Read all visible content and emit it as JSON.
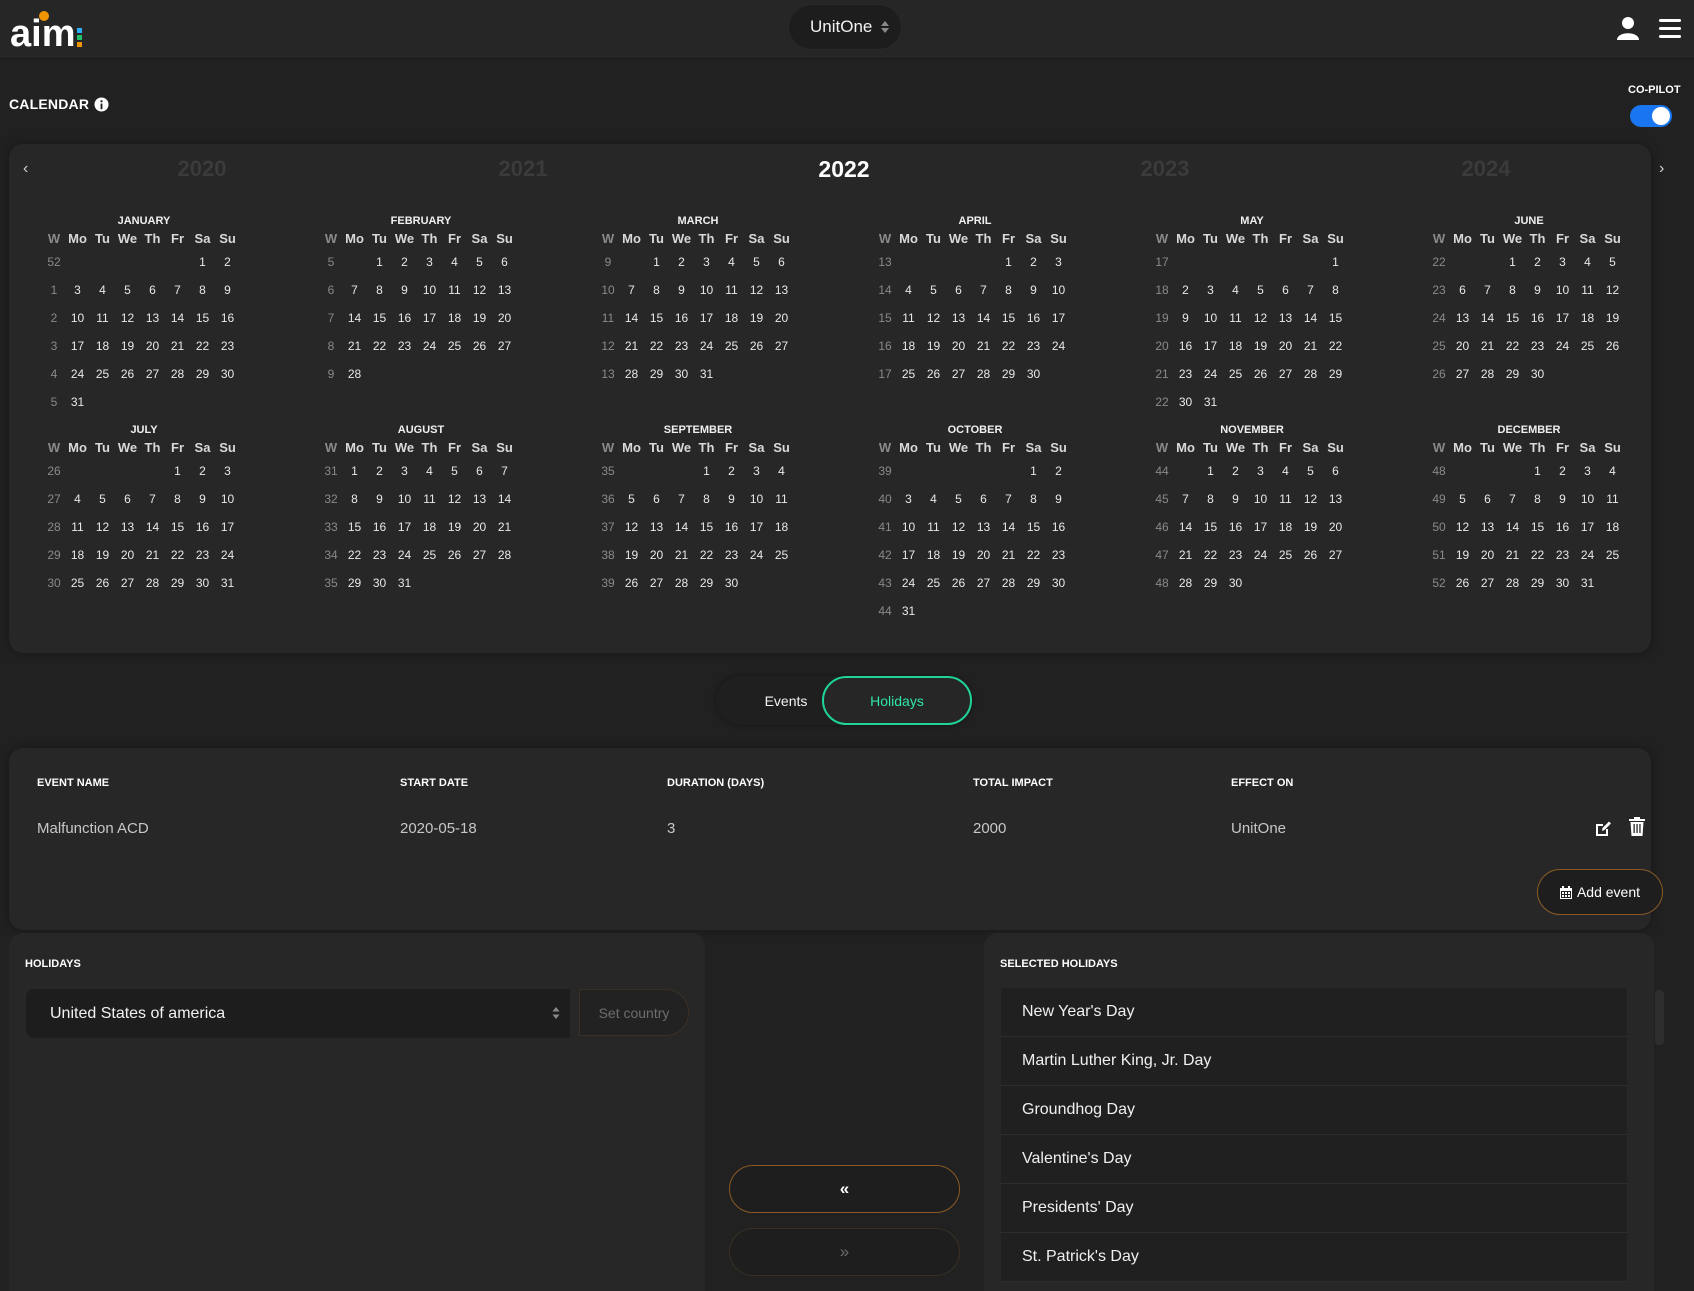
{
  "header": {
    "logo_text": "aim",
    "unit_selector": "UnitOne"
  },
  "calendar": {
    "title": "CALENDAR",
    "copilot_label": "CO-PILOT",
    "copilot_on": true,
    "years": [
      "2020",
      "2021",
      "2022",
      "2023",
      "2024"
    ],
    "current_year": "2022",
    "prev_arrow": "‹",
    "next_arrow": "›",
    "weekday_header": [
      "W",
      "Mo",
      "Tu",
      "We",
      "Th",
      "Fr",
      "Sa",
      "Su"
    ],
    "months": [
      {
        "name": "JANUARY",
        "weeks": [
          [
            52,
            "",
            "",
            "",
            "",
            "",
            1,
            2
          ],
          [
            1,
            3,
            4,
            5,
            6,
            7,
            8,
            9
          ],
          [
            2,
            10,
            11,
            12,
            13,
            14,
            15,
            16
          ],
          [
            3,
            17,
            18,
            19,
            20,
            21,
            22,
            23
          ],
          [
            4,
            24,
            25,
            26,
            27,
            28,
            29,
            30
          ],
          [
            5,
            31,
            "",
            "",
            "",
            "",
            "",
            ""
          ]
        ]
      },
      {
        "name": "FEBRUARY",
        "weeks": [
          [
            5,
            "",
            1,
            2,
            3,
            4,
            5,
            6
          ],
          [
            6,
            7,
            8,
            9,
            10,
            11,
            12,
            13
          ],
          [
            7,
            14,
            15,
            16,
            17,
            18,
            19,
            20
          ],
          [
            8,
            21,
            22,
            23,
            24,
            25,
            26,
            27
          ],
          [
            9,
            28,
            "",
            "",
            "",
            "",
            "",
            ""
          ]
        ]
      },
      {
        "name": "MARCH",
        "weeks": [
          [
            9,
            "",
            1,
            2,
            3,
            4,
            5,
            6
          ],
          [
            10,
            7,
            8,
            9,
            10,
            11,
            12,
            13
          ],
          [
            11,
            14,
            15,
            16,
            17,
            18,
            19,
            20
          ],
          [
            12,
            21,
            22,
            23,
            24,
            25,
            26,
            27
          ],
          [
            13,
            28,
            29,
            30,
            31,
            "",
            "",
            ""
          ]
        ]
      },
      {
        "name": "APRIL",
        "weeks": [
          [
            13,
            "",
            "",
            "",
            "",
            1,
            2,
            3
          ],
          [
            14,
            4,
            5,
            6,
            7,
            8,
            9,
            10
          ],
          [
            15,
            11,
            12,
            13,
            14,
            15,
            16,
            17
          ],
          [
            16,
            18,
            19,
            20,
            21,
            22,
            23,
            24
          ],
          [
            17,
            25,
            26,
            27,
            28,
            29,
            30,
            ""
          ]
        ]
      },
      {
        "name": "MAY",
        "weeks": [
          [
            17,
            "",
            "",
            "",
            "",
            "",
            "",
            1
          ],
          [
            18,
            2,
            3,
            4,
            5,
            6,
            7,
            8
          ],
          [
            19,
            9,
            10,
            11,
            12,
            13,
            14,
            15
          ],
          [
            20,
            16,
            17,
            18,
            19,
            20,
            21,
            22
          ],
          [
            21,
            23,
            24,
            25,
            26,
            27,
            28,
            29
          ],
          [
            22,
            30,
            31,
            "",
            "",
            "",
            "",
            ""
          ]
        ]
      },
      {
        "name": "JUNE",
        "weeks": [
          [
            22,
            "",
            "",
            1,
            2,
            3,
            4,
            5
          ],
          [
            23,
            6,
            7,
            8,
            9,
            10,
            11,
            12
          ],
          [
            24,
            13,
            14,
            15,
            16,
            17,
            18,
            19
          ],
          [
            25,
            20,
            21,
            22,
            23,
            24,
            25,
            26
          ],
          [
            26,
            27,
            28,
            29,
            30,
            "",
            "",
            ""
          ]
        ]
      },
      {
        "name": "JULY",
        "weeks": [
          [
            26,
            "",
            "",
            "",
            "",
            1,
            2,
            3
          ],
          [
            27,
            4,
            5,
            6,
            7,
            8,
            9,
            10
          ],
          [
            28,
            11,
            12,
            13,
            14,
            15,
            16,
            17
          ],
          [
            29,
            18,
            19,
            20,
            21,
            22,
            23,
            24
          ],
          [
            30,
            25,
            26,
            27,
            28,
            29,
            30,
            31
          ]
        ]
      },
      {
        "name": "AUGUST",
        "weeks": [
          [
            31,
            1,
            2,
            3,
            4,
            5,
            6,
            7
          ],
          [
            32,
            8,
            9,
            10,
            11,
            12,
            13,
            14
          ],
          [
            33,
            15,
            16,
            17,
            18,
            19,
            20,
            21
          ],
          [
            34,
            22,
            23,
            24,
            25,
            26,
            27,
            28
          ],
          [
            35,
            29,
            30,
            31,
            "",
            "",
            "",
            ""
          ]
        ]
      },
      {
        "name": "SEPTEMBER",
        "weeks": [
          [
            35,
            "",
            "",
            "",
            1,
            2,
            3,
            4
          ],
          [
            36,
            5,
            6,
            7,
            8,
            9,
            10,
            11
          ],
          [
            37,
            12,
            13,
            14,
            15,
            16,
            17,
            18
          ],
          [
            38,
            19,
            20,
            21,
            22,
            23,
            24,
            25
          ],
          [
            39,
            26,
            27,
            28,
            29,
            30,
            "",
            ""
          ]
        ]
      },
      {
        "name": "OCTOBER",
        "weeks": [
          [
            39,
            "",
            "",
            "",
            "",
            "",
            1,
            2
          ],
          [
            40,
            3,
            4,
            5,
            6,
            7,
            8,
            9
          ],
          [
            41,
            10,
            11,
            12,
            13,
            14,
            15,
            16
          ],
          [
            42,
            17,
            18,
            19,
            20,
            21,
            22,
            23
          ],
          [
            43,
            24,
            25,
            26,
            27,
            28,
            29,
            30
          ],
          [
            44,
            31,
            "",
            "",
            "",
            "",
            "",
            ""
          ]
        ]
      },
      {
        "name": "NOVEMBER",
        "weeks": [
          [
            44,
            "",
            1,
            2,
            3,
            4,
            5,
            6
          ],
          [
            45,
            7,
            8,
            9,
            10,
            11,
            12,
            13
          ],
          [
            46,
            14,
            15,
            16,
            17,
            18,
            19,
            20
          ],
          [
            47,
            21,
            22,
            23,
            24,
            25,
            26,
            27
          ],
          [
            48,
            28,
            29,
            30,
            "",
            "",
            "",
            ""
          ]
        ]
      },
      {
        "name": "DECEMBER",
        "weeks": [
          [
            48,
            "",
            "",
            "",
            1,
            2,
            3,
            4
          ],
          [
            49,
            5,
            6,
            7,
            8,
            9,
            10,
            11
          ],
          [
            50,
            12,
            13,
            14,
            15,
            16,
            17,
            18
          ],
          [
            51,
            19,
            20,
            21,
            22,
            23,
            24,
            25
          ],
          [
            52,
            26,
            27,
            28,
            29,
            30,
            31,
            ""
          ]
        ]
      }
    ]
  },
  "tabs": {
    "events": "Events",
    "holidays": "Holidays",
    "active": "Holidays"
  },
  "events_table": {
    "headers": [
      "EVENT NAME",
      "START DATE",
      "DURATION (DAYS)",
      "TOTAL IMPACT",
      "EFFECT ON"
    ],
    "rows": [
      {
        "name": "Malfunction ACD",
        "start": "2020-05-18",
        "duration": "3",
        "impact": "2000",
        "effect": "UnitOne"
      }
    ],
    "add_label": "Add event"
  },
  "holidays": {
    "title": "HOLIDAYS",
    "country": "United States of america",
    "set_country_label": "Set country",
    "move_left_label": "«",
    "move_right_label": "»"
  },
  "selected_holidays": {
    "title": "SELECTED HOLIDAYS",
    "items": [
      "New Year's Day",
      "Martin Luther King, Jr. Day",
      "Groundhog Day",
      "Valentine's Day",
      "Presidents' Day",
      "St. Patrick's Day"
    ]
  },
  "colors": {
    "background": "#212121",
    "panel": "#272727",
    "accent_green": "#20d39b",
    "accent_orange": "#8a5a26",
    "toggle_blue": "#1976f0"
  }
}
